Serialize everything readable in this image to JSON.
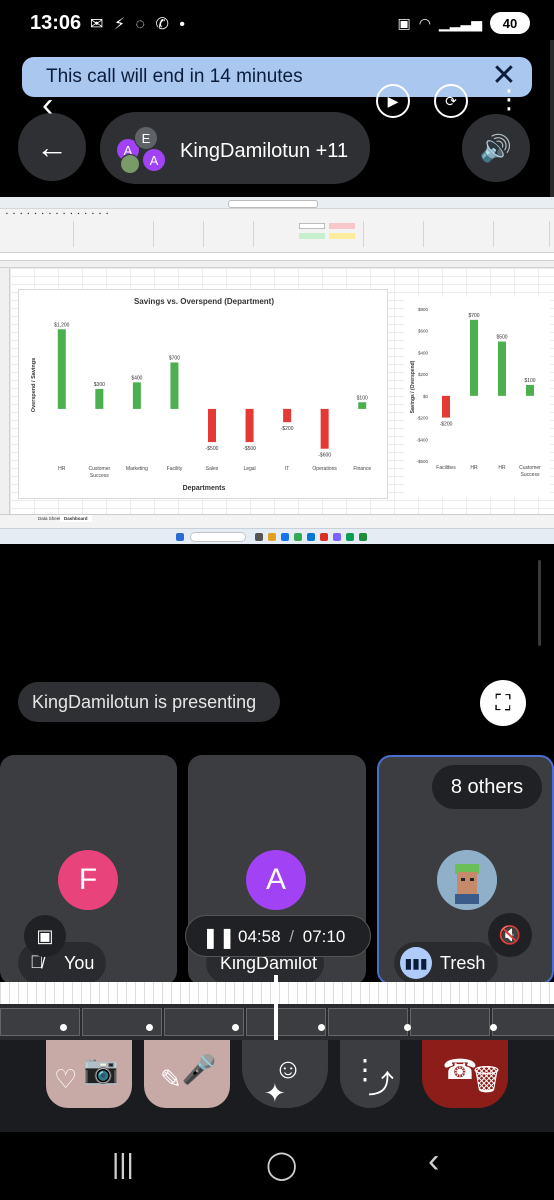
{
  "status_bar": {
    "time": "13:06",
    "left_icons": "✉ ⚡ ◌ ✆ •",
    "battery": "40"
  },
  "banner": {
    "text": "This call will end in 14 minutes",
    "close_glyph": "✕"
  },
  "overlay_controls": {
    "back_glyph": "‹",
    "more_glyph": "⋮"
  },
  "header": {
    "back_glyph": "←",
    "meeting_title": "KingDamilotun +11",
    "avatars": [
      {
        "letter": "A",
        "color": "#a142f4"
      },
      {
        "letter": "E",
        "color": "#5f6368"
      },
      {
        "letter": "A",
        "color": "#a142f4"
      }
    ],
    "speaker_glyph": "🔊"
  },
  "shared_screen": {
    "sheet_tabs": [
      "Data Sheet",
      "Dashboard"
    ],
    "main_chart": {
      "title": "Savings vs. Overspend (Department)",
      "xlabel": "Departments",
      "ylabel": "Overspend / Savings"
    },
    "side_chart": {
      "ylabel": "Savings / (Overspend)"
    }
  },
  "chart_data": [
    {
      "type": "bar",
      "title": "Savings vs. Overspend (Department)",
      "xlabel": "Departments",
      "ylabel": "Overspend / Savings",
      "categories": [
        "HR",
        "Customer Success",
        "Marketing",
        "Facility",
        "Sales",
        "Legal",
        "IT",
        "Operations",
        "Finance"
      ],
      "values": [
        1200,
        300,
        400,
        700,
        -500,
        -500,
        -200,
        -600,
        100
      ],
      "labels": [
        "$1,200",
        "$300",
        "$400",
        "$700",
        "-$500",
        "-$500",
        "-$200",
        "-$600",
        "$100"
      ],
      "colors": {
        "positive": "#4caf50",
        "negative": "#e53935"
      },
      "ylim": [
        -800,
        1400
      ]
    },
    {
      "type": "bar",
      "xlabel": "",
      "ylabel": "Savings / (Overspend)",
      "categories": [
        "Facilities",
        "HR",
        "HR",
        "Customer Success"
      ],
      "values": [
        -200,
        700,
        500,
        100
      ],
      "labels": [
        "-$200",
        "$700",
        "$500",
        "$100"
      ],
      "yticks": [
        "$800",
        "$600",
        "$400",
        "$200",
        "$0",
        "-$200",
        "-$400",
        "-$600"
      ],
      "colors": {
        "positive": "#4caf50",
        "negative": "#e53935"
      },
      "ylim": [
        -600,
        800
      ]
    }
  ],
  "presenting": {
    "text": "KingDamilotun is presenting",
    "fullscreen_glyph": "⛶"
  },
  "tiles": [
    {
      "letter": "F",
      "color": "#e8437a",
      "name": "You"
    },
    {
      "letter": "A",
      "color": "#a142f4",
      "name": "KingDamilot"
    },
    {
      "letter": "",
      "color": "#5b7fa3",
      "name": "Tresh"
    }
  ],
  "others": {
    "label": "8 others"
  },
  "playback": {
    "pause_glyph": "❚❚",
    "current": "04:58",
    "separator": "/",
    "total": "07:10"
  },
  "controls": {
    "camera_glyph": "📷",
    "mic_glyph": "🎤",
    "emoji_glyph": "☺",
    "share_glyph": "⋮",
    "end_glyph": "☎",
    "like_glyph": "♡",
    "edit_glyph": "✎",
    "ai_glyph": "✦",
    "delete_glyph": "🗑"
  },
  "nav": {
    "recents": "|||",
    "home": "◯",
    "back": "‹"
  }
}
